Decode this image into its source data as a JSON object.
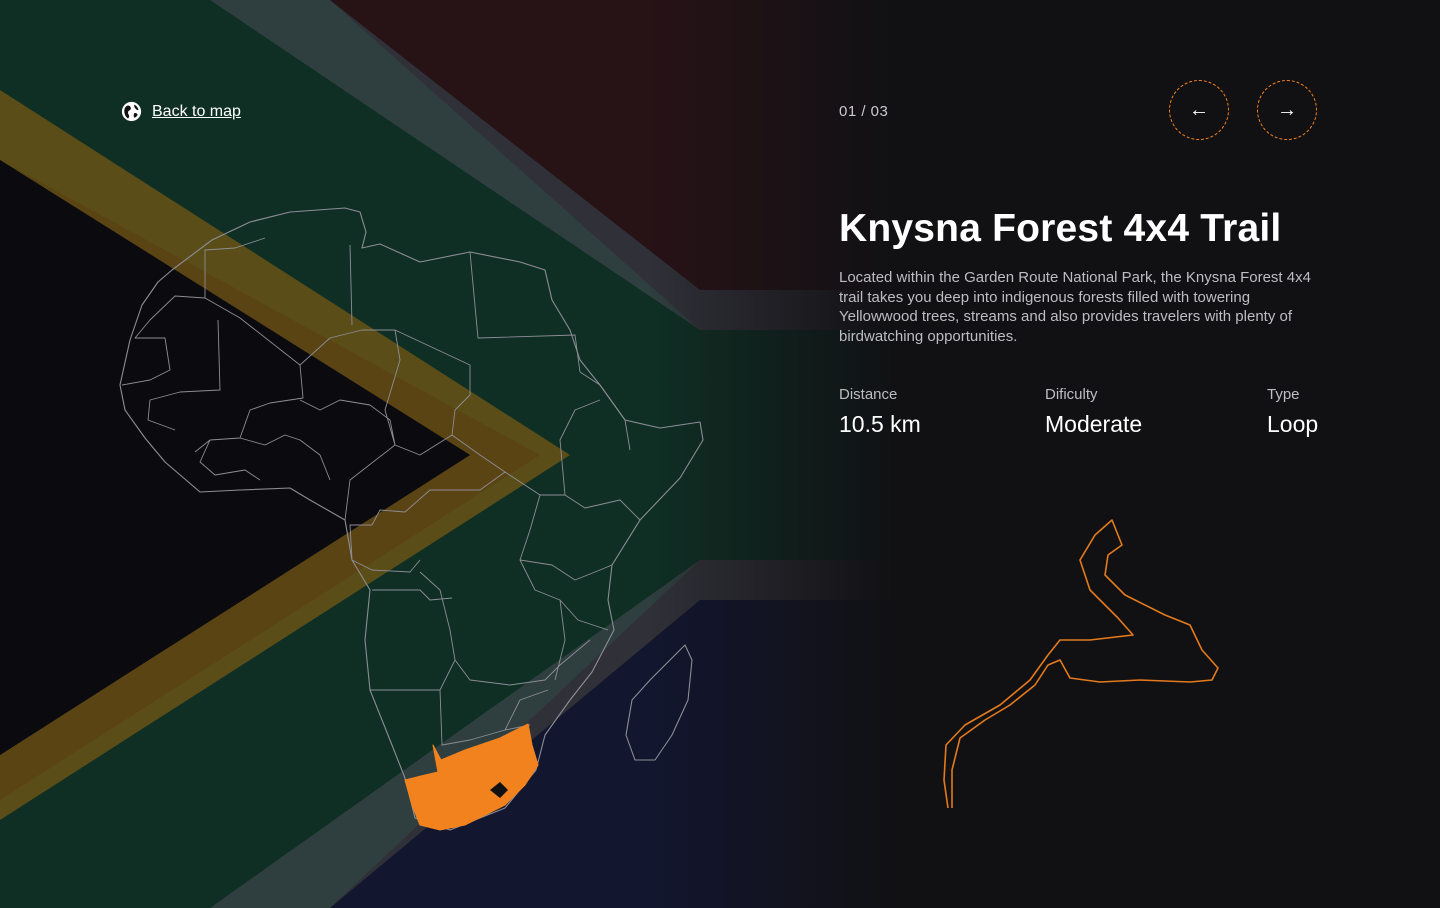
{
  "nav": {
    "back_label": "Back to map",
    "counter": "01 / 03",
    "prev_icon": "arrow-left-icon",
    "next_icon": "arrow-right-icon",
    "prev_glyph": "←",
    "next_glyph": "→"
  },
  "trail": {
    "title": "Knysna Forest 4x4 Trail",
    "description": "Located within the Garden Route National Park, the Knysna Forest 4x4 trail takes you deep into indigenous forests filled with towering Yellowwood trees, streams and also provides travelers with plenty of birdwatching opportunities.",
    "stats": {
      "distance": {
        "label": "Distance",
        "value": "10.5 km"
      },
      "difficulty": {
        "label": "Dificulty",
        "value": "Moderate"
      },
      "type": {
        "label": "Type",
        "value": "Loop"
      }
    }
  },
  "map": {
    "highlighted_country": "South Africa",
    "highlight_color": "#f2821e"
  },
  "colors": {
    "accent": "#f2821e",
    "background": "#111114",
    "flag_green": "#0f3a2a",
    "flag_gold": "#7a5a14",
    "flag_red": "#3a1418",
    "flag_blue": "#12183a",
    "flag_white": "#4a4a55"
  }
}
